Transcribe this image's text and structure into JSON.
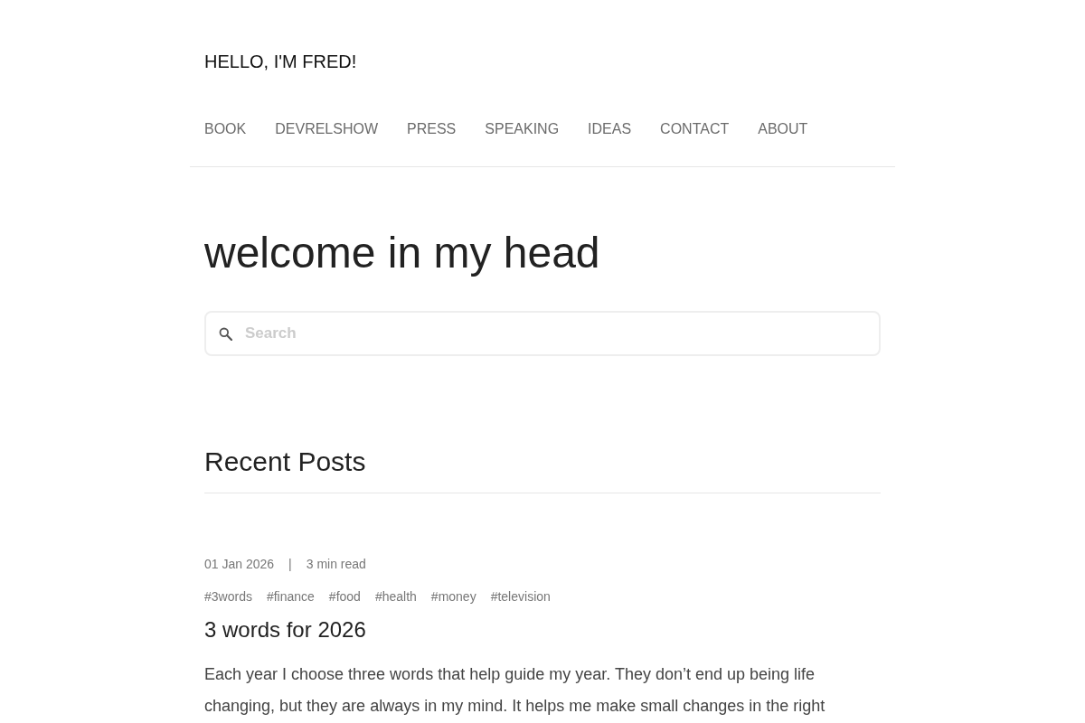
{
  "site": {
    "title": "HELLO, I'M FRED!"
  },
  "nav": [
    "BOOK",
    "DEVRELSHOW",
    "PRESS",
    "SPEAKING",
    "IDEAS",
    "CONTACT",
    "ABOUT"
  ],
  "hero": {
    "heading": "welcome in my head"
  },
  "search": {
    "placeholder": "Search"
  },
  "recent": {
    "heading": "Recent Posts",
    "posts": [
      {
        "date": "01 Jan 2026",
        "separator": "|",
        "read_time": "3 min read",
        "tags": [
          "#3words",
          "#finance",
          "#food",
          "#health",
          "#money",
          "#television"
        ],
        "title": "3 words for 2026",
        "excerpt": "Each year I choose three words that help guide my year. They don’t end up being life changing, but they are always in my mind. It helps me make small changes in the right"
      }
    ]
  }
}
